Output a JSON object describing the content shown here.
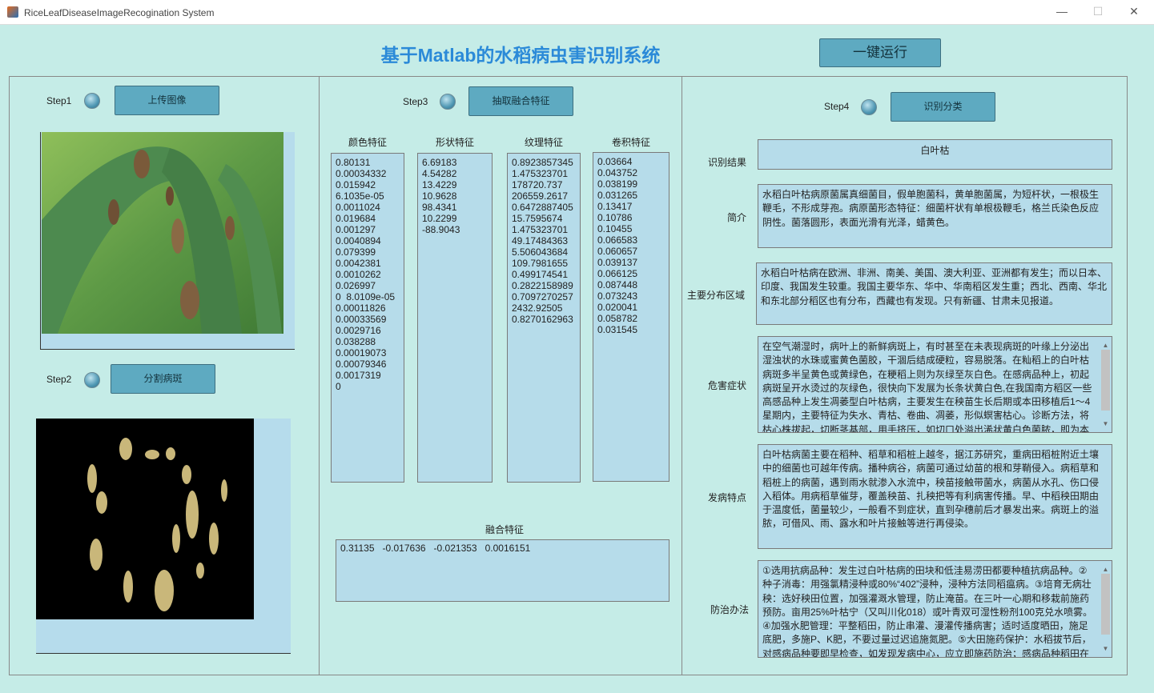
{
  "window": {
    "title": "RiceLeafDiseaseImageRecogination System",
    "minimize": "—",
    "maximize": "☐",
    "close": "✕"
  },
  "header": {
    "title": "基于Matlab的水稻病虫害识别系统",
    "run_all": "一键运行"
  },
  "left": {
    "step1": "Step1",
    "upload": "上传图像",
    "step2": "Step2",
    "segment": "分割病斑"
  },
  "middle": {
    "step3": "Step3",
    "extract": "抽取融合特征",
    "columns": [
      {
        "header": "颜色特征",
        "values": [
          "0.80131",
          "0.00034332",
          "0.015942",
          "6.1035e-05",
          "0.0011024",
          "0.019684",
          "0.001297",
          "0.0040894",
          "0.079399",
          "0.0042381",
          "0.0010262",
          "0.026997",
          "0  8.0109e-05",
          "0.00011826",
          "0.00033569",
          "0.0029716",
          "0.038288",
          "0.00019073",
          "0.00079346",
          "0.0017319",
          "0"
        ]
      },
      {
        "header": "形状特征",
        "values": [
          "6.69183",
          "4.54282",
          "13.4229",
          "10.9628",
          "98.4341",
          "10.2299",
          "-88.9043"
        ]
      },
      {
        "header": "纹理特征",
        "values": [
          "0.8923857345",
          "1.475323701",
          "178720.737",
          "206559.2617",
          "0.6472887405",
          "15.7595674",
          "1.475323701",
          "49.17484363",
          "5.506043684",
          "109.7981655",
          "0.499174541",
          "0.2822158989",
          "0.7097270257",
          "2432.92505",
          "0.8270162963"
        ]
      },
      {
        "header": "卷积特征",
        "values": [
          "0.03664",
          "0.043752",
          "0.038199",
          "0.031265",
          "0.13417",
          "0.10786",
          "0.10455",
          "0.066583",
          "0.060657",
          "0.039137",
          "0.066125",
          "0.087448",
          "0.073243",
          "0.020041",
          "0.058782",
          "0.031545"
        ]
      }
    ],
    "fusion_label": "融合特征",
    "fusion_value": "0.31135   -0.017636   -0.021353   0.0016151"
  },
  "right": {
    "step4": "Step4",
    "classify": "识别分类",
    "result_label": "识别结果",
    "result": "白叶枯",
    "intro_label": "简介",
    "intro": "水稻白叶枯病原菌属真细菌目，假单胞菌科，黄单胞菌属，为短杆状，一根极生鞭毛，不形成芽孢。病原菌形态特征：细菌杆状有单根极鞭毛，格兰氏染色反应阴性。菌落圆形，表面光滑有光泽，蜡黄色。",
    "region_label": "主要分布区域",
    "region": "水稻白叶枯病在欧洲、非洲、南美、美国、澳大利亚、亚洲都有发生；而以日本、印度、我国发生较重。我国主要华东、华中、华南稻区发生重；西北、西南、华北和东北部分稻区也有分布，西藏也有发现。只有新疆、甘肃未见报道。",
    "symptom_label": "危害症状",
    "symptom": "在空气潮湿时，病叶上的新鲜病斑上，有时甚至在未表现病斑的叶缘上分泌出湿浊状的水珠或蜜黄色菌胶，干涸后结成硬粒，容易脱落。在籼稻上的白叶枯病斑多半呈黄色或黄绿色，在粳稻上则为灰绿至灰白色。在感病品种上，初起病斑呈开水烫过的灰绿色，很快向下发展为长条状黄白色,在我国南方稻区一些高感品种上发生凋萎型白叶枯病，主要发生在秧苗生长后期或本田移植后1～4星期内，主要特征为失水、青枯、卷曲、凋萎，形似螟害枯心。诊断方法，将枯心株拔起，切断茎基部，用手挤压，如切口处溢出浠状黄白色菌脓，即为本",
    "feature_label": "发病特点",
    "feature": "白叶枯病菌主要在稻种、稻草和稻桩上越冬，据江苏研究，重病田稻桩附近土壤中的细菌也可越年传病。播种病谷，病菌可通过幼苗的根和芽鞘侵入。病稻草和稻桩上的病菌，遇到雨水就渗入水流中，秧苗接触带菌水，病菌从水孔、伤口侵入稻体。用病稻草催芽，覆盖秧苗、扎秧把等有利病害传播。早、中稻秧田期由于温度低，菌量较少，一般看不到症状，直到孕穗前后才暴发出来。病斑上的溢脓，可借风、雨、露水和叶片接触等进行再侵染。",
    "control_label": "防治办法",
    "control": "①选用抗病品种：发生过白叶枯病的田块和低洼易涝田都要种植抗病品种。②种子消毒：用强氯精浸种或80%“402”浸种，浸种方法同稻瘟病。③培育无病壮秧：选好秧田位置，加强灌溉水管理，防止淹苗。在三叶一心期和移栽前施药预防。亩用25%叶枯宁（又叫川化018）或叶青双可湿性粉剂100克兑水喷雾。④加强水肥管理：平整稻田，防止串灌、漫灌传播病害；适时适度晒田，施足底肥，多施P、K肥，不要过量过迟追施氮肥。⑤大田施药保护：水稻拔节后，对感病品种要即早检查，如发现发病中心，应立即施药防治；感病品种稻田在"
  }
}
